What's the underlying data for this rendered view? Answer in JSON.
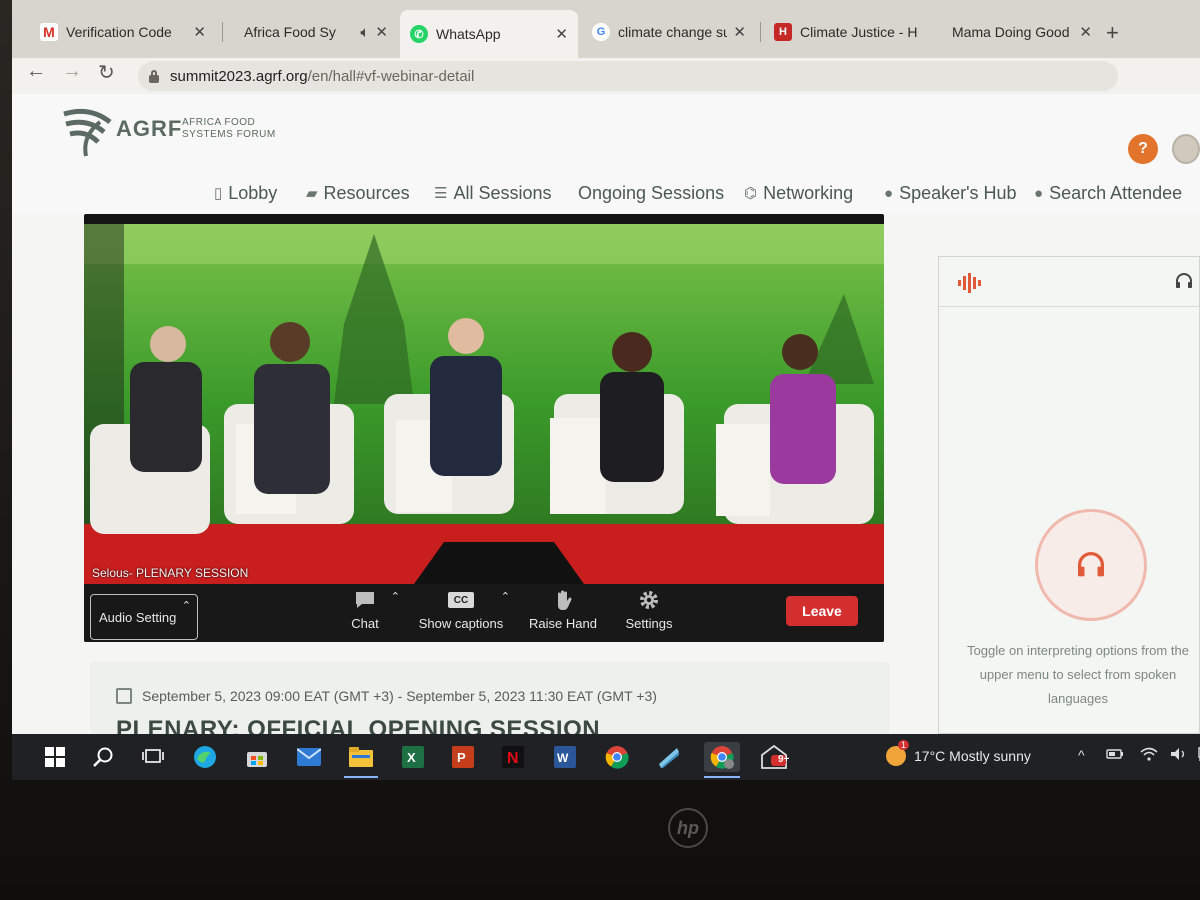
{
  "browser": {
    "tabs": [
      {
        "title": "Verification Code",
        "icon": "gmail-icon",
        "color": "#d93025",
        "glyph": "M"
      },
      {
        "title": "Africa Food Sy",
        "icon": "speaker-icon",
        "color": "#8a8a8a",
        "glyph": ""
      },
      {
        "title": "WhatsApp",
        "icon": "whatsapp-icon",
        "color": "#25d366",
        "glyph": "✆"
      },
      {
        "title": "climate change sur",
        "icon": "google-icon",
        "color": "#4285f4",
        "glyph": "G"
      },
      {
        "title": "Climate Justice - H",
        "icon": "h-icon",
        "color": "#c62828",
        "glyph": "H"
      },
      {
        "title": "Mama Doing Good",
        "icon": "site-icon",
        "color": "#c77",
        "glyph": ""
      }
    ],
    "url": {
      "host": "summit2023.agrf.org",
      "path": "/en/hall#vf-webinar-detail"
    }
  },
  "site": {
    "logo": {
      "name": "AGRF",
      "sub1": "AFRICA   FOOD",
      "sub2": "SYSTEMS FORUM"
    },
    "nav": [
      {
        "label": "Lobby",
        "icon": "lobby-icon",
        "glyph": "▯"
      },
      {
        "label": "Resources",
        "icon": "bag-icon",
        "glyph": "▰"
      },
      {
        "label": "All Sessions",
        "icon": "list-icon",
        "glyph": "☰"
      },
      {
        "label": "Ongoing Sessions",
        "icon": "",
        "glyph": ""
      },
      {
        "label": "Networking",
        "icon": "chat-bubbles-icon",
        "glyph": "⌬"
      },
      {
        "label": "Speaker's Hub",
        "icon": "user-icon",
        "glyph": "●"
      },
      {
        "label": "Search Attendee",
        "icon": "user-icon",
        "glyph": "●"
      }
    ],
    "help_glyph": "?"
  },
  "player": {
    "session_label": "Selous- PLENARY SESSION",
    "audio_setting": "Audio Setting",
    "controls": {
      "chat": "Chat",
      "captions": "Show captions",
      "raise_hand": "Raise Hand",
      "settings": "Settings",
      "cc": "CC"
    },
    "leave": "Leave"
  },
  "interpretation": {
    "message": "Toggle on interpreting options from the upper menu to select from spoken languages",
    "accent": "#e05a3a"
  },
  "session": {
    "date_range": "September 5, 2023 09:00 EAT (GMT +3) - September 5, 2023 11:30 EAT (GMT +3)",
    "title": "PLENARY: OFFICIAL OPENING SESSION"
  },
  "taskbar": {
    "apps": [
      "windows-start-icon",
      "search-icon",
      "task-view-icon",
      "edge-icon",
      "store-icon",
      "mail-icon",
      "file-explorer-icon",
      "excel-icon",
      "powerpoint-icon",
      "netflix-icon",
      "word-icon",
      "chrome-icon",
      "app-icon",
      "chrome-profile-icon",
      "mail-notify-icon"
    ],
    "notify_badge": "9+",
    "weather_badge": "1",
    "weather": "17°C  Mostly sunny"
  }
}
